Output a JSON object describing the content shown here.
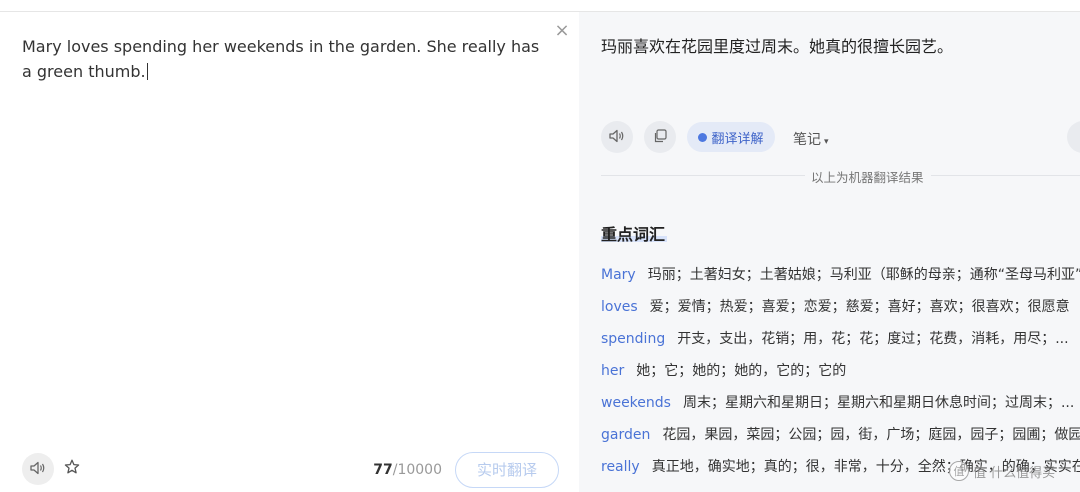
{
  "source": {
    "text": "Mary loves spending her weekends in the garden. She really has a green thumb.",
    "char_count": "77",
    "char_limit": "/10000",
    "realtime_label": "实时翻译",
    "close_glyph": "×"
  },
  "target": {
    "text": "玛丽喜欢在花园里度过周末。她真的很擅长园艺。",
    "detail_label": "翻译详解",
    "notes_label": "笔记",
    "notes_caret": "▾",
    "machine_note": "以上为机器翻译结果"
  },
  "vocab": {
    "title": "重点词汇",
    "items": [
      {
        "word": "Mary",
        "def": "玛丽；土著妇女；土著姑娘；马利亚（耶稣的母亲；通称“圣母马利亚”"
      },
      {
        "word": "loves",
        "def": "爱；爱情；热爱；喜爱；恋爱；慈爱；喜好；喜欢；很喜欢；很愿意"
      },
      {
        "word": "spending",
        "def": "开支，支出，花销；用，花；花；度过；花费，消耗，用尽；..."
      },
      {
        "word": "her",
        "def": "她；它；她的；她的，它的；它的"
      },
      {
        "word": "weekends",
        "def": "周末；星期六和星期日；星期六和星期日休息时间；过周末；..."
      },
      {
        "word": "garden",
        "def": "花园，果园，菜园；公园；园，街，广场；庭园，园子；园圃；做园艺"
      },
      {
        "word": "really",
        "def": "真正地，确实地；真的；很，非常，十分，全然；确实，的确；实实在在"
      }
    ]
  },
  "watermark": {
    "text": "值 什么值得买",
    "icon": "chat-bubble-icon"
  },
  "colors": {
    "accent": "#4a73d6",
    "right_bg": "#f6f7f9",
    "realtime_text": "#b7cbee"
  }
}
